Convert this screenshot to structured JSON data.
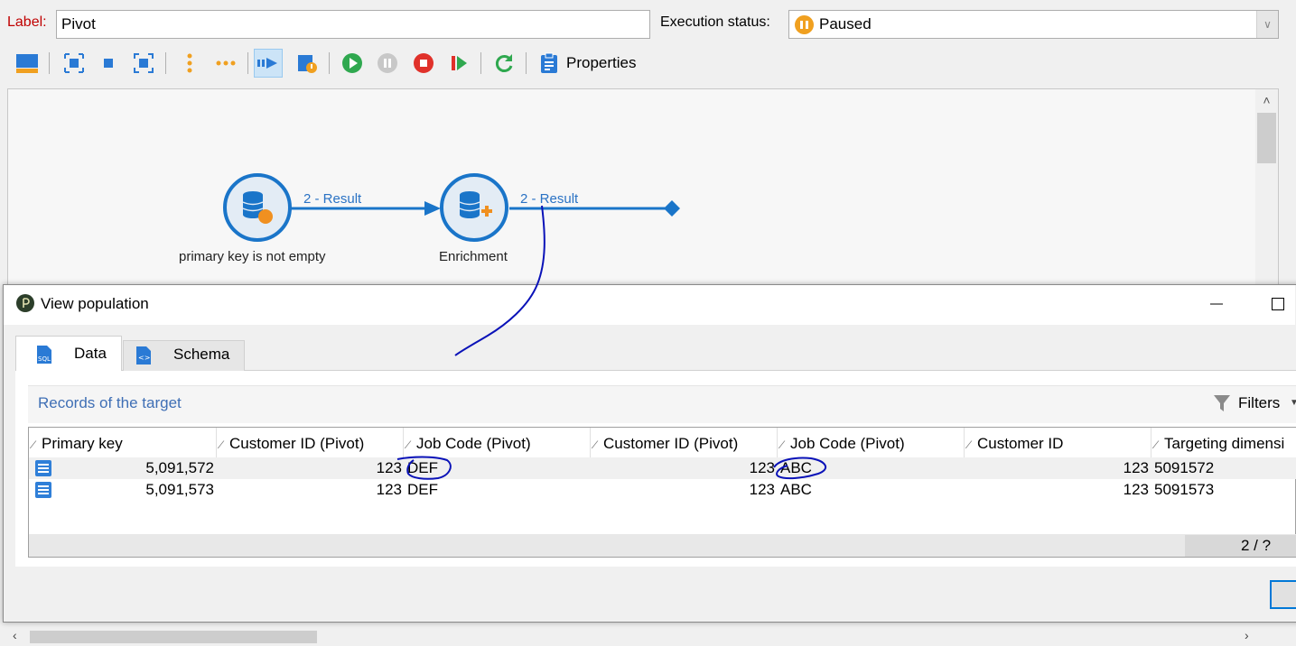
{
  "header": {
    "label_caption": "Label:",
    "label_value": "Pivot",
    "exec_caption": "Execution status:",
    "exec_value": "Paused"
  },
  "toolbar": {
    "icons": [
      "layout-icon",
      "select-all-icon",
      "square-icon",
      "fit-icon",
      "vertical-dots-icon",
      "horizontal-dots-icon",
      "transition-icon",
      "log-icon",
      "start-icon",
      "pause-icon",
      "stop-icon",
      "resume-icon",
      "refresh-icon",
      "properties-icon"
    ],
    "properties_label": "Properties"
  },
  "canvas": {
    "node1_label": "primary key is not empty",
    "node2_label": "Enrichment",
    "edge1_label": "2 - Result",
    "edge2_label": "2 - Result"
  },
  "dialog": {
    "title": "View population",
    "tabs": [
      {
        "label": "Data",
        "active": true
      },
      {
        "label": "Schema",
        "active": false
      }
    ],
    "records_title": "Records of the target",
    "filters_label": "Filters",
    "columns": [
      "Primary key",
      "Customer ID (Pivot)",
      "Job Code (Pivot)",
      "Customer ID (Pivot)",
      "Job Code (Pivot)",
      "Customer ID",
      "Targeting dimensi"
    ],
    "rows": [
      [
        "5,091,572",
        "123",
        "DEF",
        "123",
        "ABC",
        "123",
        "5091572"
      ],
      [
        "5,091,573",
        "123",
        "DEF",
        "123",
        "ABC",
        "123",
        "5091573"
      ]
    ],
    "pager": "2 / ?"
  },
  "colors": {
    "accent": "#0078d7",
    "label_red": "#c00000",
    "link_blue": "#3f6fb5",
    "flow_blue": "#1a75c9",
    "status_orange": "#f0a020",
    "annotation_ink": "#0a12b8"
  }
}
